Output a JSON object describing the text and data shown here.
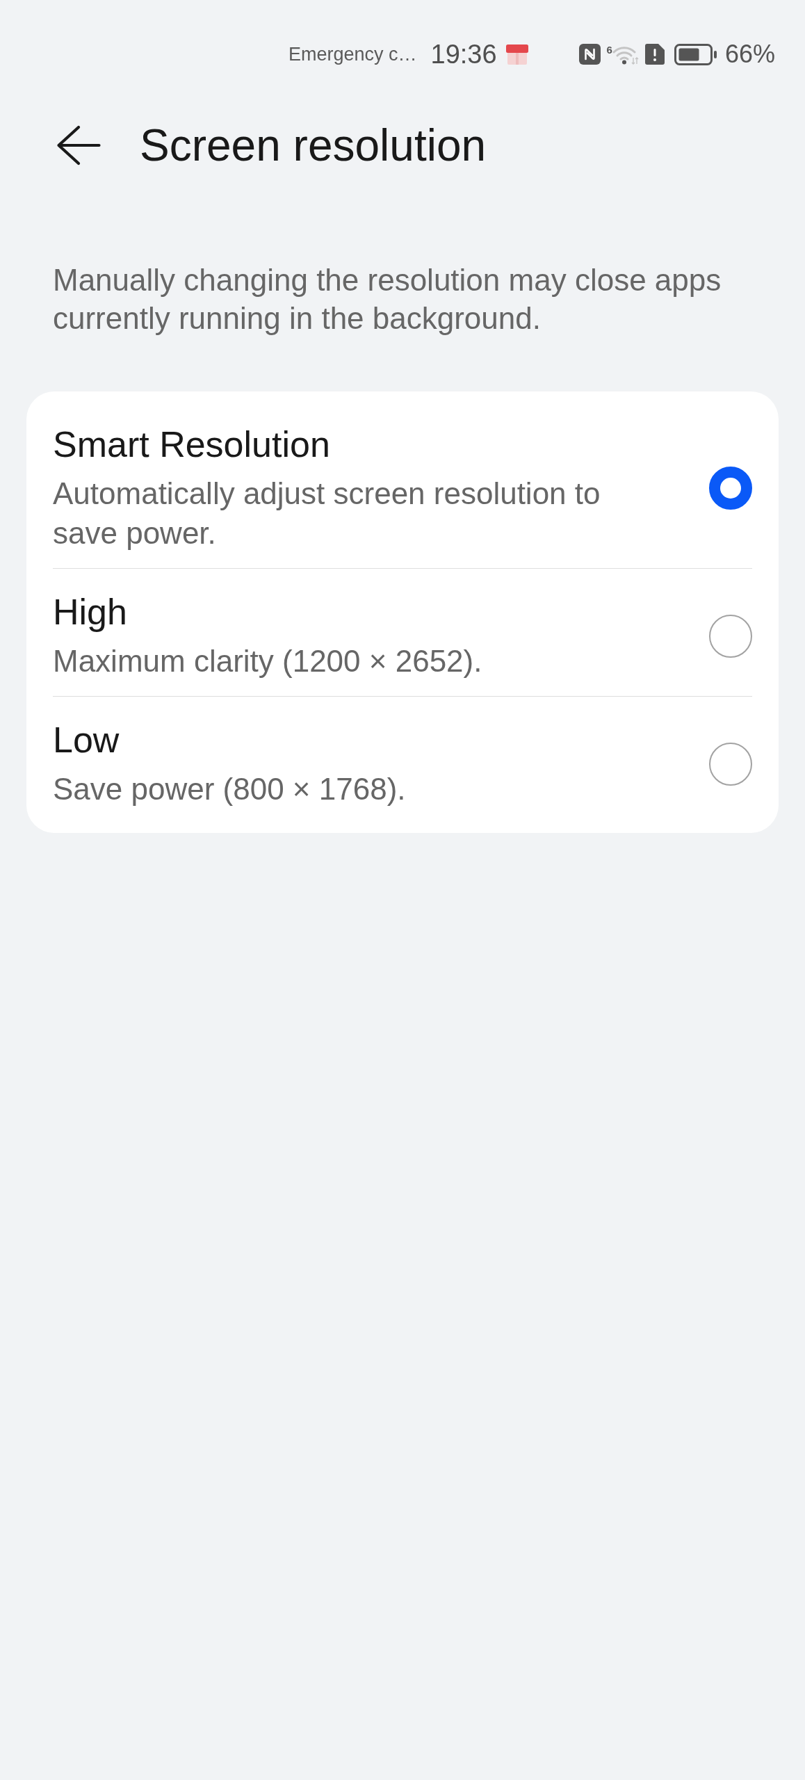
{
  "status_bar": {
    "notification": "Emergency c…",
    "time": "19:36",
    "wifi_badge": "6",
    "battery_text": "66%"
  },
  "header": {
    "title": "Screen resolution"
  },
  "description": "Manually changing the resolution may close apps currently running in the background.",
  "options": [
    {
      "title": "Smart Resolution",
      "subtitle": "Automatically adjust screen resolution to save power.",
      "selected": true
    },
    {
      "title": "High",
      "subtitle": "Maximum clarity (1200 × 2652).",
      "selected": false
    },
    {
      "title": "Low",
      "subtitle": "Save power (800 × 1768).",
      "selected": false
    }
  ]
}
